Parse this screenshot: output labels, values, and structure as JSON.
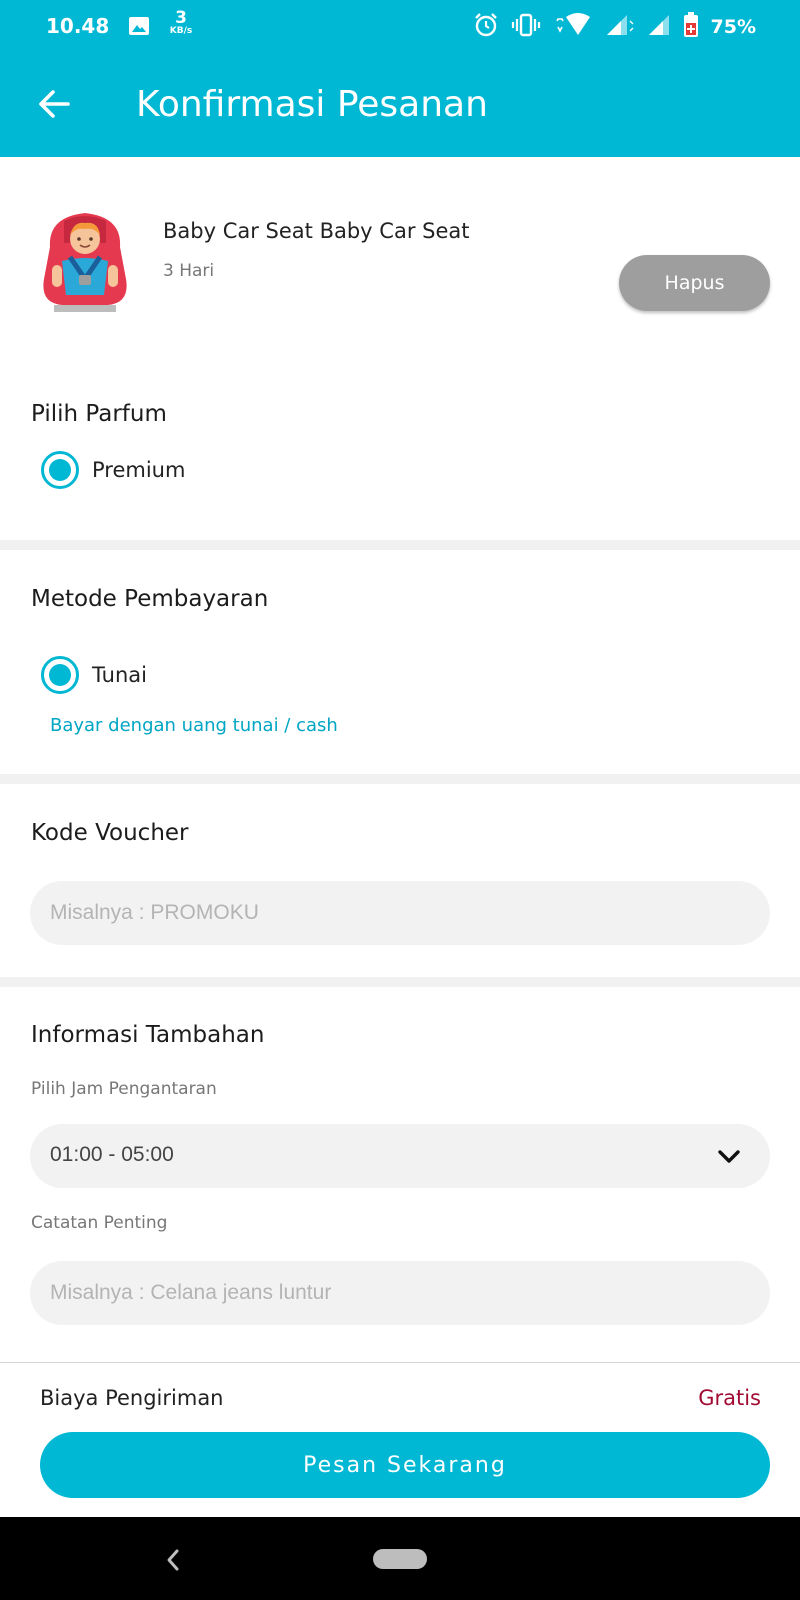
{
  "status_bar": {
    "time": "10.48",
    "network_speed_value": "3",
    "network_speed_unit": "KB/s",
    "battery_percent": "75%",
    "icons": [
      "image-icon",
      "alarm-icon",
      "vibrate-icon",
      "wifi-icon",
      "signal-icon",
      "signal-icon",
      "battery-icon"
    ]
  },
  "app_bar": {
    "title": "Konfirmasi Pesanan",
    "back_icon": "arrow-left-icon"
  },
  "product": {
    "name": "Baby Car Seat Baby Car Seat",
    "duration": "3 Hari",
    "delete_label": "Hapus",
    "image_icon": "baby-car-seat-icon"
  },
  "parfum": {
    "title": "Pilih Parfum",
    "option": "Premium",
    "selected": true
  },
  "payment": {
    "title": "Metode Pembayaran",
    "option": "Tunai",
    "selected": true,
    "note": "Bayar dengan uang tunai / cash"
  },
  "voucher": {
    "title": "Kode Voucher",
    "placeholder": "Misalnya : PROMOKU",
    "value": ""
  },
  "extra": {
    "title": "Informasi Tambahan",
    "delivery_time_label": "Pilih Jam Pengantaran",
    "delivery_time_value": "01:00 - 05:00",
    "notes_label": "Catatan Penting",
    "notes_placeholder": "Misalnya : Celana jeans luntur",
    "notes_value": ""
  },
  "footer": {
    "shipping_label": "Biaya Pengiriman",
    "shipping_value": "Gratis",
    "order_button": "Pesan Sekarang"
  },
  "colors": {
    "primary": "#00B8D4",
    "delete_button": "#9E9E9E",
    "free_text": "#A10B33",
    "note_text": "#00A6C4"
  }
}
